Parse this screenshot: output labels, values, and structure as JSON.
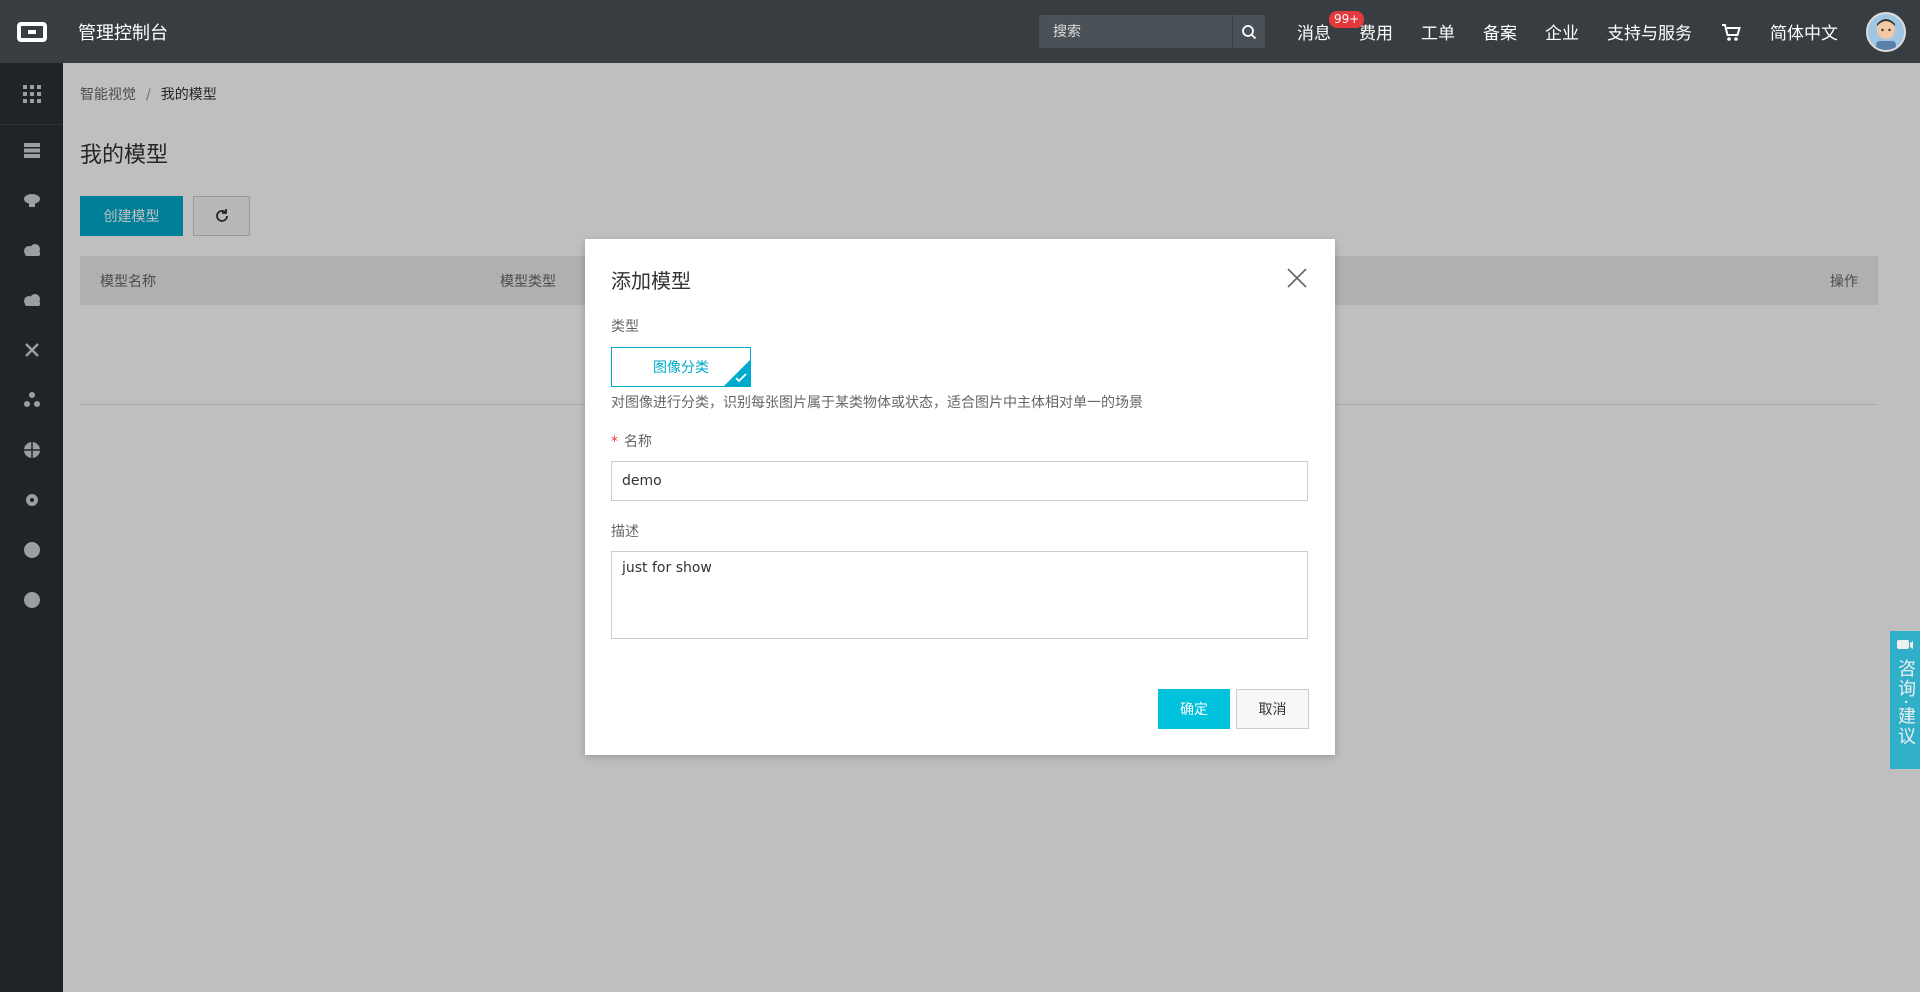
{
  "topbar": {
    "console_title": "管理控制台",
    "search_placeholder": "搜索",
    "nav": {
      "messages": "消息",
      "messages_badge": "99+",
      "billing": "费用",
      "tickets": "工单",
      "icp": "备案",
      "enterprise": "企业",
      "support": "支持与服务",
      "language": "简体中文"
    }
  },
  "sidebar": {
    "icons": [
      "grid-icon",
      "server-icon",
      "robot-icon",
      "cloud-icon",
      "cloud-upload-icon",
      "cross-icon",
      "cluster-icon",
      "globe-icon",
      "gear-cloud-icon",
      "dot-icon",
      "dot-icon"
    ]
  },
  "breadcrumb": {
    "parent": "智能视觉",
    "separator": "/",
    "current": "我的模型"
  },
  "page": {
    "title": "我的模型",
    "create_button": "创建模型"
  },
  "table": {
    "columns": [
      "模型名称",
      "模型类型",
      "操作"
    ]
  },
  "modal": {
    "title": "添加模型",
    "type_label": "类型",
    "type_option": "图像分类",
    "type_description": "对图像进行分类，识别每张图片属于某类物体或状态，适合图片中主体相对单一的场景",
    "name_required_mark": "*",
    "name_label": "名称",
    "name_value": "demo",
    "desc_label": "描述",
    "desc_value": "just for show",
    "ok_button": "确定",
    "cancel_button": "取消"
  },
  "feedback": {
    "text": "咨询·建议"
  },
  "colors": {
    "topbar_bg": "#373d41",
    "sidebar_bg": "#2b3033",
    "accent": "#00c1de",
    "primary_button": "#00aacc",
    "badge": "#e4393c"
  }
}
